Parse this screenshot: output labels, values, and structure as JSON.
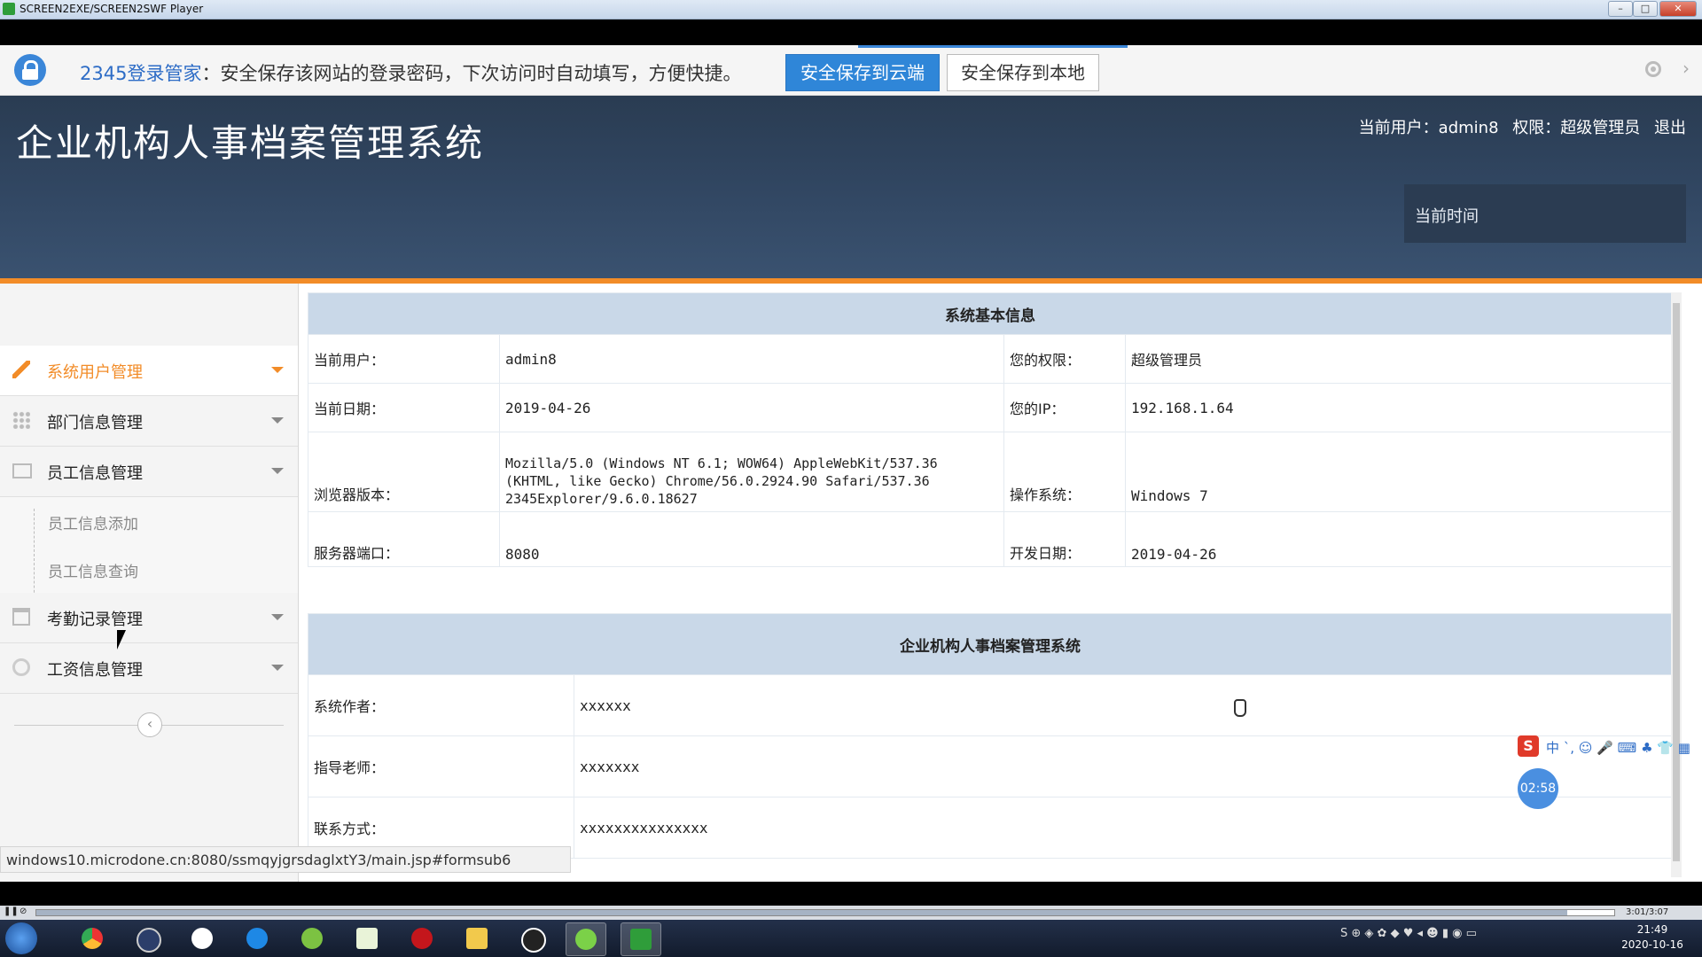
{
  "player": {
    "title": "SCREEN2EXE/SCREEN2SWF Player",
    "time": "3:01/3:07",
    "progress": 0.97
  },
  "password_bar": {
    "brand": "2345登录管家",
    "message": "：安全保存该网站的登录密码，下次访问时自动填写，方便快捷。",
    "btn_cloud": "安全保存到云端",
    "btn_local": "安全保存到本地",
    "colors": {
      "primary": "#2f86d8"
    }
  },
  "header": {
    "title": "企业机构人事档案管理系统",
    "current_user_label": "当前用户：",
    "current_user": "admin8",
    "role_label": "权限：",
    "role": "超级管理员",
    "logout": "退出",
    "time_label": "当前时间"
  },
  "sidebar": {
    "items": [
      {
        "label": "系统用户管理",
        "icon": "pencil-icon",
        "active": true
      },
      {
        "label": "部门信息管理",
        "icon": "grid-icon"
      },
      {
        "label": "员工信息管理",
        "icon": "image-icon"
      },
      {
        "label": "考勤记录管理",
        "icon": "calendar-icon"
      },
      {
        "label": "工资信息管理",
        "icon": "wheel-icon"
      }
    ],
    "sub_items": [
      "员工信息添加",
      "员工信息查询"
    ],
    "collapse": "‹"
  },
  "system_info": {
    "heading": "系统基本信息",
    "rows": [
      {
        "l1": "当前用户：",
        "v1": "admin8",
        "l2": "您的权限：",
        "v2": "超级管理员"
      },
      {
        "l1": "当前日期：",
        "v1": "2019-04-26",
        "l2": "您的IP：",
        "v2": "192.168.1.64"
      },
      {
        "l1": "浏览器版本：",
        "v1": "Mozilla/5.0 (Windows NT 6.1; WOW64) AppleWebKit/537.36 (KHTML, like Gecko) Chrome/56.0.2924.90 Safari/537.36 2345Explorer/9.6.0.18627",
        "l2": "操作系统：",
        "v2": "Windows 7"
      },
      {
        "l1": "服务器端口：",
        "v1": "8080",
        "l2": "开发日期：",
        "v2": "2019-04-26"
      }
    ]
  },
  "about": {
    "heading": "企业机构人事档案管理系统",
    "rows": [
      {
        "label": "系统作者：",
        "value": "xxxxxx"
      },
      {
        "label": "指导老师：",
        "value": "xxxxxxx"
      },
      {
        "label": "联系方式：",
        "value": "xxxxxxxxxxxxxxx"
      }
    ]
  },
  "status_url": "windows10.microdone.cn:8080/ssmqyjgrsdaglxtY3/main.jsp#formsub6",
  "overlays": {
    "ime_logo": "S",
    "ime_text": "中 ˋ, ☺ 🎤 ⌨ ♣ 👕 ▦",
    "timer": "02:58"
  },
  "clock": {
    "time": "21:49",
    "date": "2020-10-16"
  }
}
